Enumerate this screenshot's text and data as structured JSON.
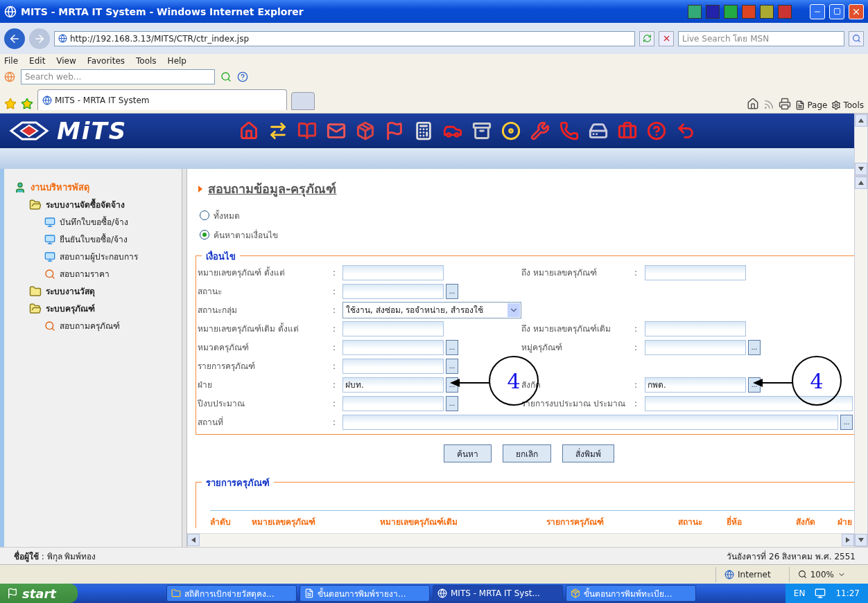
{
  "window": {
    "title": "MITS - MRTA IT System - Windows Internet Explorer"
  },
  "address_bar": {
    "url": "http://192.168.3.13/MITS/CTR/ctr_index.jsp",
    "search_placeholder": "Live Search โดย MSN"
  },
  "menu": [
    "File",
    "Edit",
    "View",
    "Favorites",
    "Tools",
    "Help"
  ],
  "toolbar": {
    "search_placeholder": "Search web..."
  },
  "tabs": [
    {
      "label": "MITS - MRTA IT System",
      "selected": true
    }
  ],
  "command_bar": [
    "Page",
    "Tools"
  ],
  "app": {
    "logo": "MiTS",
    "sidebar": {
      "title": "งานบริหารพัสดุ",
      "items": [
        {
          "label": "ระบบงานจัดซื้อจัดจ้าง",
          "kind": "folder",
          "expanded": true,
          "children": [
            {
              "label": "บันทึกใบขอซื้อ/จ้าง",
              "kind": "form"
            },
            {
              "label": "ยืนยันใบขอซื้อ/จ้าง",
              "kind": "form"
            },
            {
              "label": "สอบถามผู้ประกอบการ",
              "kind": "form"
            },
            {
              "label": "สอบถามราคา",
              "kind": "search"
            }
          ]
        },
        {
          "label": "ระบบงานวัสดุ",
          "kind": "folder",
          "expanded": false
        },
        {
          "label": "ระบบครุภัณฑ์",
          "kind": "folder",
          "expanded": true,
          "children": [
            {
              "label": "สอบถามครุภัณฑ์",
              "kind": "search"
            }
          ]
        }
      ]
    },
    "page_title": "สอบถามข้อมูล-ครุภัณฑ์",
    "scope": [
      {
        "label": "ทั้งหมด",
        "selected": false
      },
      {
        "label": "ค้นหาตามเงื่อนไข",
        "selected": true
      }
    ],
    "criteria": {
      "title": "เงื่อนไข",
      "rows": [
        {
          "left": {
            "label": "หมายเลขครุภัณฑ์ ตั้งแต่",
            "colon": ":",
            "kind": "text"
          },
          "right": {
            "label": "ถึง หมายเลขครุภัณฑ์",
            "colon": ":",
            "kind": "text"
          }
        },
        {
          "left": {
            "label": "สถานะ",
            "colon": ":",
            "kind": "lookup",
            "button": "..."
          }
        },
        {
          "left": {
            "label": "สถานะกลุ่ม",
            "colon": ":",
            "kind": "select",
            "value": "ใช้งาน, ส่งซ่อม, รอจำหน่าย, สำรองใช้"
          }
        },
        {
          "left": {
            "label": "หมายเลขครุภัณฑ์เดิม ตั้งแต่",
            "colon": ":",
            "kind": "text"
          },
          "right": {
            "label": "ถึง หมายเลขครุภัณฑ์เดิม",
            "colon": ":",
            "kind": "text"
          }
        },
        {
          "left": {
            "label": "หมวดครุภัณฑ์",
            "colon": ":",
            "kind": "lookup",
            "button": "..."
          },
          "right": {
            "label": "หมู่ครุภัณฑ์",
            "colon": ":",
            "kind": "lookup",
            "button": "..."
          }
        },
        {
          "left": {
            "label": "รายการครุภัณฑ์",
            "colon": ":",
            "kind": "lookup",
            "button": "..."
          }
        },
        {
          "left": {
            "label": "ฝ่าย",
            "colon": ":",
            "kind": "lookup",
            "value": "ฝบท.",
            "button": "..."
          },
          "right": {
            "label": "สังกัด",
            "colon": ":",
            "kind": "lookup",
            "value": "กพด.",
            "button": "..."
          }
        },
        {
          "left": {
            "label": "ปีงบประมาณ",
            "colon": ":",
            "kind": "lookup",
            "button": "..."
          },
          "right": {
            "label": "รายการงบประมาณ ประมาณ",
            "colon": ":",
            "kind": "wide"
          }
        },
        {
          "left": {
            "label": "สถานที่",
            "colon": ":",
            "kind": "wide_lookup",
            "button": "..."
          }
        }
      ]
    },
    "buttons": [
      "ค้นหา",
      "ยกเลิก",
      "สั่งพิมพ์"
    ],
    "results": {
      "title": "รายการครุภัณฑ์",
      "columns": [
        "ลำดับ",
        "หมายเลขครุภัณฑ์",
        "หมายเลขครุภัณฑ์เดิม",
        "รายการครุภัณฑ์",
        "สถานะ",
        "ยี่ห้อ",
        "สังกัด",
        "ฝ่าย"
      ]
    },
    "annotations": [
      {
        "label": "4"
      },
      {
        "label": "4"
      }
    ],
    "footer": {
      "user": "**ชื่อผู้ใช้** : พิกุล พิมพ์ทอง",
      "date": "วันอังคารที่ 26 สิงหาคม พ.ศ. 2551"
    }
  },
  "status_bar": {
    "zone": "Internet",
    "zoom": "100%"
  },
  "taskbar": {
    "start": "start",
    "tasks": [
      {
        "label": "สถิติการเบิกจ่ายวัสดุคง...",
        "kind": "folder",
        "selected": false
      },
      {
        "label": "ขั้นตอนการพิมพ์รายงา...",
        "kind": "document",
        "selected": false
      },
      {
        "label": "MITS - MRTA IT Syst...",
        "kind": "browser",
        "selected": true
      },
      {
        "label": "ขั้นตอนการพิมพ์ทะเบีย...",
        "kind": "app",
        "selected": false
      }
    ],
    "language": "EN",
    "time": "11:27"
  }
}
